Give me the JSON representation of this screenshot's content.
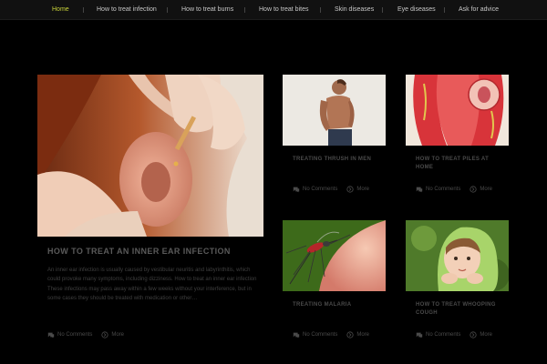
{
  "nav": {
    "items": [
      {
        "label": "Home",
        "active": true
      },
      {
        "label": "How to treat infection",
        "active": false
      },
      {
        "label": "How to treat burns",
        "active": false
      },
      {
        "label": "How to treat bites",
        "active": false
      },
      {
        "label": "Skin diseases",
        "active": false
      },
      {
        "label": "Eye diseases",
        "active": false
      },
      {
        "label": "Ask for advice",
        "active": false
      }
    ],
    "active_color": "#c9d33a"
  },
  "featured": {
    "title": "HOW TO TREAT AN INNER EAR INFECTION",
    "excerpt": "An inner ear infection is usually caused by vestibular neuritis and labyrinthitis, which could provoke many symptoms, including dizziness. How to treat an inner ear infection These infections may pass away within a few weeks without your interference, but in some cases they should be treated with medication or other…",
    "comments_label": "No Comments",
    "more_label": "More",
    "image_icon": "ear-drops-photo"
  },
  "cards": [
    {
      "title": "TREATING THRUSH IN MEN",
      "comments_label": "No Comments",
      "more_label": "More",
      "image_icon": "shirtless-man-photo"
    },
    {
      "title": "HOW TO TREAT PILES AT HOME",
      "comments_label": "No Comments",
      "more_label": "More",
      "image_icon": "anatomy-illustration"
    },
    {
      "title": "TREATING MALARIA",
      "comments_label": "No Comments",
      "more_label": "More",
      "image_icon": "mosquito-on-skin-photo"
    },
    {
      "title": "HOW TO TREAT WHOOPING COUGH",
      "comments_label": "No Comments",
      "more_label": "More",
      "image_icon": "child-in-green-hood-photo"
    }
  ],
  "icons": {
    "comments": "comments-icon",
    "more": "more-circle-icon"
  }
}
